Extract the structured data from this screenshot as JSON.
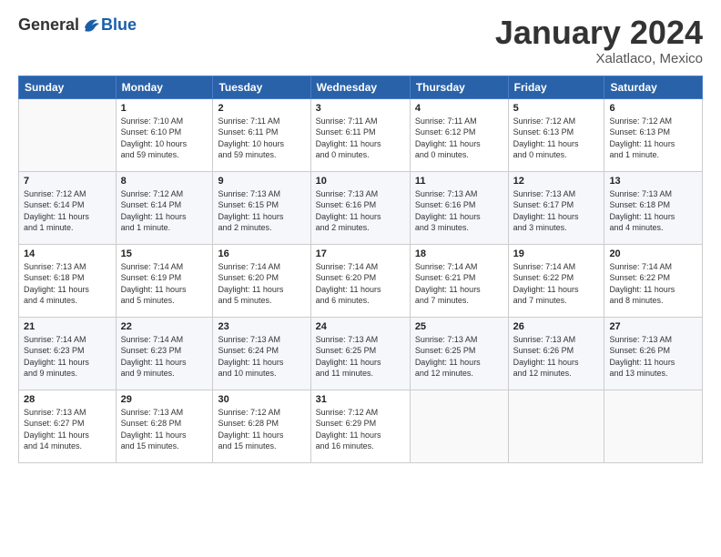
{
  "header": {
    "logo_general": "General",
    "logo_blue": "Blue",
    "title": "January 2024",
    "location": "Xalatlaco, Mexico"
  },
  "days_of_week": [
    "Sunday",
    "Monday",
    "Tuesday",
    "Wednesday",
    "Thursday",
    "Friday",
    "Saturday"
  ],
  "weeks": [
    [
      {
        "num": "",
        "info": ""
      },
      {
        "num": "1",
        "info": "Sunrise: 7:10 AM\nSunset: 6:10 PM\nDaylight: 10 hours\nand 59 minutes."
      },
      {
        "num": "2",
        "info": "Sunrise: 7:11 AM\nSunset: 6:11 PM\nDaylight: 10 hours\nand 59 minutes."
      },
      {
        "num": "3",
        "info": "Sunrise: 7:11 AM\nSunset: 6:11 PM\nDaylight: 11 hours\nand 0 minutes."
      },
      {
        "num": "4",
        "info": "Sunrise: 7:11 AM\nSunset: 6:12 PM\nDaylight: 11 hours\nand 0 minutes."
      },
      {
        "num": "5",
        "info": "Sunrise: 7:12 AM\nSunset: 6:13 PM\nDaylight: 11 hours\nand 0 minutes."
      },
      {
        "num": "6",
        "info": "Sunrise: 7:12 AM\nSunset: 6:13 PM\nDaylight: 11 hours\nand 1 minute."
      }
    ],
    [
      {
        "num": "7",
        "info": "Sunrise: 7:12 AM\nSunset: 6:14 PM\nDaylight: 11 hours\nand 1 minute."
      },
      {
        "num": "8",
        "info": "Sunrise: 7:12 AM\nSunset: 6:14 PM\nDaylight: 11 hours\nand 1 minute."
      },
      {
        "num": "9",
        "info": "Sunrise: 7:13 AM\nSunset: 6:15 PM\nDaylight: 11 hours\nand 2 minutes."
      },
      {
        "num": "10",
        "info": "Sunrise: 7:13 AM\nSunset: 6:16 PM\nDaylight: 11 hours\nand 2 minutes."
      },
      {
        "num": "11",
        "info": "Sunrise: 7:13 AM\nSunset: 6:16 PM\nDaylight: 11 hours\nand 3 minutes."
      },
      {
        "num": "12",
        "info": "Sunrise: 7:13 AM\nSunset: 6:17 PM\nDaylight: 11 hours\nand 3 minutes."
      },
      {
        "num": "13",
        "info": "Sunrise: 7:13 AM\nSunset: 6:18 PM\nDaylight: 11 hours\nand 4 minutes."
      }
    ],
    [
      {
        "num": "14",
        "info": "Sunrise: 7:13 AM\nSunset: 6:18 PM\nDaylight: 11 hours\nand 4 minutes."
      },
      {
        "num": "15",
        "info": "Sunrise: 7:14 AM\nSunset: 6:19 PM\nDaylight: 11 hours\nand 5 minutes."
      },
      {
        "num": "16",
        "info": "Sunrise: 7:14 AM\nSunset: 6:20 PM\nDaylight: 11 hours\nand 5 minutes."
      },
      {
        "num": "17",
        "info": "Sunrise: 7:14 AM\nSunset: 6:20 PM\nDaylight: 11 hours\nand 6 minutes."
      },
      {
        "num": "18",
        "info": "Sunrise: 7:14 AM\nSunset: 6:21 PM\nDaylight: 11 hours\nand 7 minutes."
      },
      {
        "num": "19",
        "info": "Sunrise: 7:14 AM\nSunset: 6:22 PM\nDaylight: 11 hours\nand 7 minutes."
      },
      {
        "num": "20",
        "info": "Sunrise: 7:14 AM\nSunset: 6:22 PM\nDaylight: 11 hours\nand 8 minutes."
      }
    ],
    [
      {
        "num": "21",
        "info": "Sunrise: 7:14 AM\nSunset: 6:23 PM\nDaylight: 11 hours\nand 9 minutes."
      },
      {
        "num": "22",
        "info": "Sunrise: 7:14 AM\nSunset: 6:23 PM\nDaylight: 11 hours\nand 9 minutes."
      },
      {
        "num": "23",
        "info": "Sunrise: 7:13 AM\nSunset: 6:24 PM\nDaylight: 11 hours\nand 10 minutes."
      },
      {
        "num": "24",
        "info": "Sunrise: 7:13 AM\nSunset: 6:25 PM\nDaylight: 11 hours\nand 11 minutes."
      },
      {
        "num": "25",
        "info": "Sunrise: 7:13 AM\nSunset: 6:25 PM\nDaylight: 11 hours\nand 12 minutes."
      },
      {
        "num": "26",
        "info": "Sunrise: 7:13 AM\nSunset: 6:26 PM\nDaylight: 11 hours\nand 12 minutes."
      },
      {
        "num": "27",
        "info": "Sunrise: 7:13 AM\nSunset: 6:26 PM\nDaylight: 11 hours\nand 13 minutes."
      }
    ],
    [
      {
        "num": "28",
        "info": "Sunrise: 7:13 AM\nSunset: 6:27 PM\nDaylight: 11 hours\nand 14 minutes."
      },
      {
        "num": "29",
        "info": "Sunrise: 7:13 AM\nSunset: 6:28 PM\nDaylight: 11 hours\nand 15 minutes."
      },
      {
        "num": "30",
        "info": "Sunrise: 7:12 AM\nSunset: 6:28 PM\nDaylight: 11 hours\nand 15 minutes."
      },
      {
        "num": "31",
        "info": "Sunrise: 7:12 AM\nSunset: 6:29 PM\nDaylight: 11 hours\nand 16 minutes."
      },
      {
        "num": "",
        "info": ""
      },
      {
        "num": "",
        "info": ""
      },
      {
        "num": "",
        "info": ""
      }
    ]
  ]
}
